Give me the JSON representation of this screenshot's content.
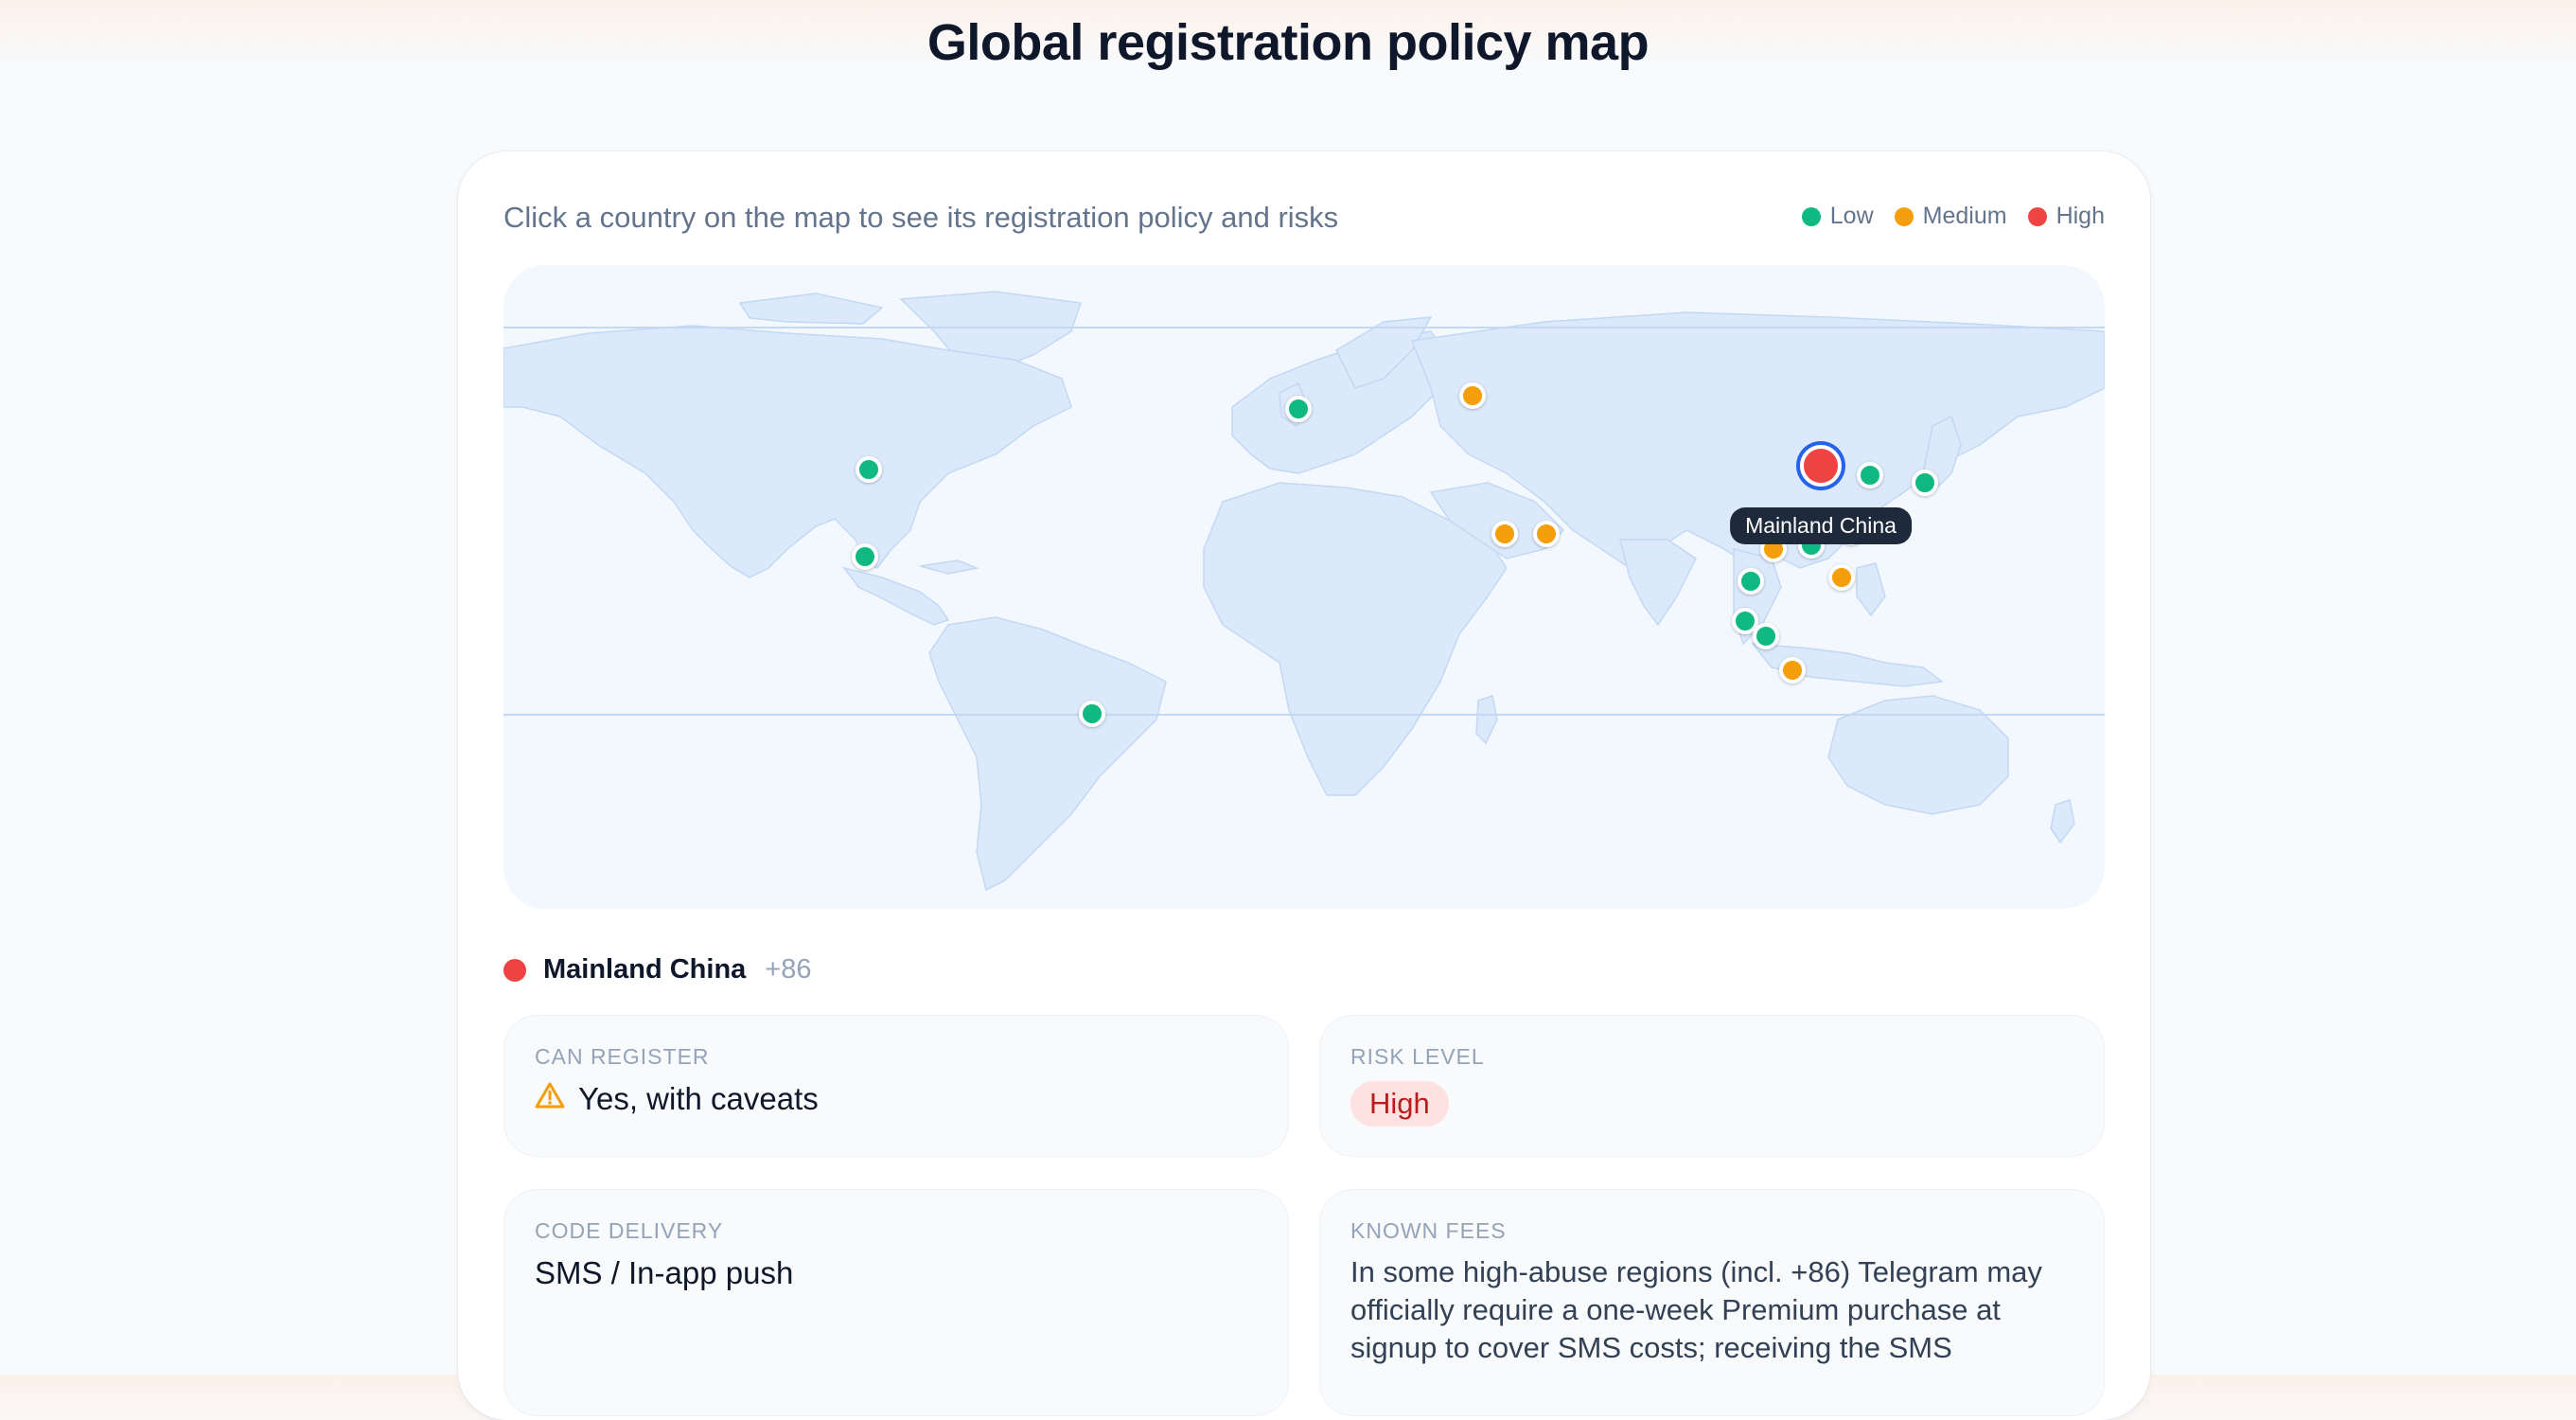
{
  "header": {
    "title": "Global registration policy map"
  },
  "map_panel": {
    "hint": "Click a country on the map to see its registration policy and risks",
    "legend": [
      {
        "label": "Low",
        "color": "#10b981"
      },
      {
        "label": "Medium",
        "color": "#f59e0b"
      },
      {
        "label": "High",
        "color": "#ef4444"
      }
    ],
    "selected_tooltip": "Mainland China"
  },
  "colors": {
    "low": "#10b981",
    "medium": "#f59e0b",
    "high": "#ef4444",
    "land": "#dbe9fb",
    "ocean": "#f3f8fe",
    "selection_ring": "#2563eb"
  },
  "selected": {
    "name": "Mainland China",
    "code": "+86",
    "risk": "High"
  },
  "details": {
    "can_register_label": "CAN REGISTER",
    "can_register_value": "Yes, with caveats",
    "can_register_icon": "warning-icon",
    "risk_level_label": "RISK LEVEL",
    "risk_level_value": "High",
    "code_delivery_label": "CODE DELIVERY",
    "code_delivery_value": "SMS / In-app push",
    "known_fees_label": "KNOWN FEES",
    "known_fees_value": "In some high-abuse regions (incl. +86) Telegram may officially require a one-week Premium purchase at signup to cover SMS costs; receiving the SMS"
  }
}
